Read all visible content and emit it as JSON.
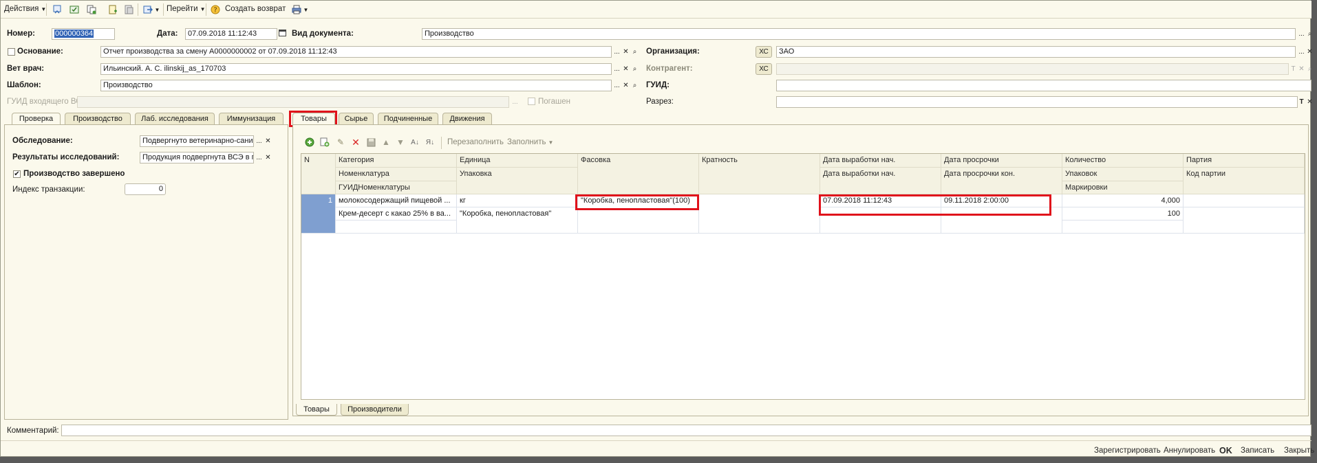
{
  "toolbar": {
    "actions": "Действия",
    "goto": "Перейти",
    "create_return": "Создать возврат"
  },
  "header": {
    "number_label": "Номер:",
    "number_value": "000000364",
    "date_label": "Дата:",
    "date_value": "07.09.2018 11:12:43",
    "doc_type_label": "Вид документа:",
    "doc_type_value": "Производство",
    "basis_label": "Основание:",
    "basis_value": "Отчет производства за смену А0000000002 от 07.09.2018 11:12:43",
    "org_label": "Организация:",
    "org_xc": "ХС",
    "org_value": "ЗАО",
    "vet_label": "Вет врач:",
    "vet_value": "Ильинский. А. С. ilinskij_as_170703",
    "counterparty_label": "Контрагент:",
    "counterparty_xc": "ХС",
    "counterparty_value": "",
    "template_label": "Шаблон:",
    "template_value": "Производство",
    "guid_label": "ГУИД:",
    "guid_value": "",
    "incoming_guid_label": "ГУИД входящего ВСД:",
    "incoming_guid_value": "",
    "repaid_label": "Погашен",
    "section_label": "Разрез:",
    "section_value": ""
  },
  "left_tabs": [
    "Проверка",
    "Производство",
    "Лаб. исследования",
    "Иммунизация"
  ],
  "right_tabs": [
    "Товары",
    "Сырье",
    "Подчиненные",
    "Движения"
  ],
  "check_panel": {
    "exam_label": "Обследование:",
    "exam_value": "Подвергнуто ветеринарно-сани",
    "results_label": "Результаты исследований:",
    "results_value": "Продукция подвергнута ВСЭ в г",
    "production_done_label": "Производство завершено",
    "production_done_checked": "✔",
    "tx_index_label": "Индекс транзакции:",
    "tx_index_value": "0"
  },
  "grid_toolbar": {
    "refill": "Перезаполнить",
    "fill": "Заполнить"
  },
  "grid": {
    "headers_row1": [
      "N",
      "Категория",
      "Единица",
      "Фасовка",
      "Кратность",
      "Дата выработки нач.",
      "Дата просрочки",
      "Количество",
      "Партия"
    ],
    "headers_row2": [
      "Номенклатура",
      "Упаковка",
      "Дата выработки нач.",
      "Дата просрочки кон.",
      "Упаковок",
      "Код партии"
    ],
    "headers_row3": [
      "ГУИДНоменклатуры",
      "Маркировки"
    ],
    "row": {
      "n": "1",
      "category": "молокосодержащий пищевой ...",
      "unit": "кг",
      "packing": "\"Коробка, пенопластовая\"(100)",
      "multiplicity": "",
      "prod_date_start": "07.09.2018 11:12:43",
      "expiry_date": "09.11.2018 2:00:00",
      "quantity": "4,000",
      "batch": "",
      "nomenclature": "Крем-десерт с какао 25% в ва...",
      "package": "\"Коробка, пенопластовая\"",
      "packages_count": "100"
    }
  },
  "bottom_tabs": [
    "Товары",
    "Производители"
  ],
  "comment_label": "Комментарий:",
  "comment_value": "",
  "status_bar": {
    "register": "Зарегистрировать",
    "annul": "Аннулировать",
    "ok": "OK",
    "save": "Записать",
    "close": "Закрыть"
  },
  "colors": {
    "highlight_box": "#e0121b",
    "selected_row_cell": "#7f9fd0",
    "background": "#fbf9ec"
  }
}
